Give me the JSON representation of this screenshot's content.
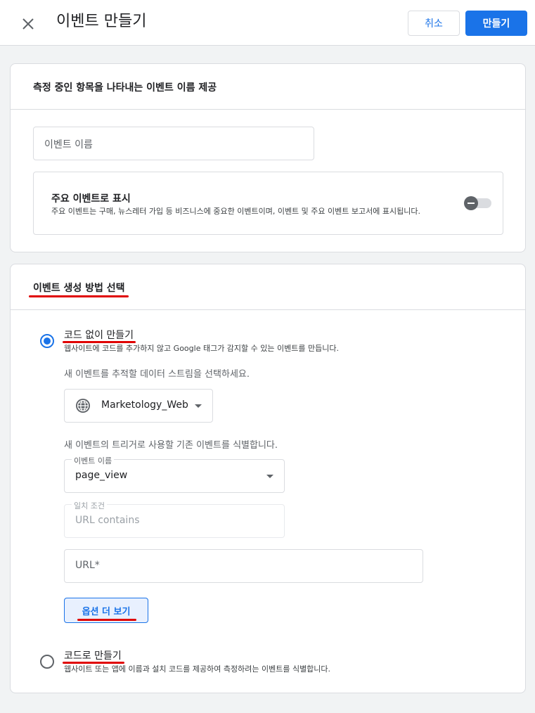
{
  "header": {
    "title": "이벤트 만들기",
    "cancel_label": "취소",
    "create_label": "만들기",
    "close_icon": "close-icon"
  },
  "card1": {
    "title": "측정 중인 항목을 나타내는 이벤트 이름 제공",
    "event_name_placeholder": "이벤트 이름",
    "key_event": {
      "title": "주요 이벤트로 표시",
      "description": "주요 이벤트는 구매, 뉴스레터 가입 등 비즈니스에 중요한 이벤트이며, 이벤트 및 주요 이벤트 보고서에 표시됩니다.",
      "enabled": false
    }
  },
  "card2": {
    "title": "이벤트 생성 방법 선택",
    "option_no_code": {
      "title": "코드 없이 만들기",
      "description": "웹사이트에 코드를 추가하지 않고 Google 태그가 감지할 수 있는 이벤트를 만듭니다.",
      "selected": true
    },
    "stream_prompt": "새 이벤트를 추적할 데이터 스트림을 선택하세요.",
    "stream_value": "Marketology_Web",
    "stream_icon": "globe-icon",
    "trigger_prompt": "새 이벤트의 트리거로 사용할 기존 이벤트를 식별합니다.",
    "event_name_field": {
      "label": "이벤트 이름",
      "value": "page_view"
    },
    "match_condition_field": {
      "label": "일치 조건",
      "value": "URL contains"
    },
    "url_field": {
      "placeholder": "URL*"
    },
    "more_options_label": "옵션 더 보기",
    "option_code": {
      "title": "코드로 만들기",
      "description": "웹사이트 또는 앱에 이름과 설치 코드를 제공하여 측정하려는 이벤트를 식별합니다.",
      "selected": false
    }
  },
  "colors": {
    "accent": "#1a73e8",
    "annotation": "#e00000"
  }
}
